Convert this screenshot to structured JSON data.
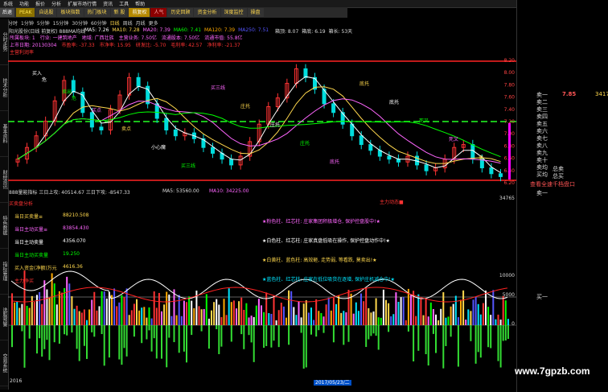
{
  "menu": [
    "系统",
    "功能",
    "报价",
    "分析",
    "扩展市场行情",
    "资讯",
    "工具",
    "帮助"
  ],
  "toolbar": {
    "back_label": "后退",
    "buttons": [
      {
        "label": "PEAK",
        "style": "hot"
      },
      {
        "label": "自选股",
        "style": "yellow"
      },
      {
        "label": "板块指数",
        "style": "yellow"
      },
      {
        "label": "热门板块",
        "style": "yellow"
      },
      {
        "label": "新 股",
        "style": "yellow"
      },
      {
        "label": "前复权",
        "style": "active"
      },
      {
        "label": "人气",
        "style": "red"
      },
      {
        "label": "历史回顾",
        "style": "yellow"
      },
      {
        "label": "资金分析",
        "style": "yellow"
      },
      {
        "label": "深度监控",
        "style": "yellow"
      },
      {
        "label": "操盘",
        "style": "yellow"
      }
    ]
  },
  "periods": [
    "分时",
    "1分钟",
    "5分钟",
    "15分钟",
    "30分钟",
    "60分钟",
    "日线",
    "周线",
    "月线",
    "更多"
  ],
  "active_period": "日线",
  "sidebar_tabs": [
    "分",
    "时",
    "走",
    "势",
    "技",
    "术",
    "分",
    "析",
    "基",
    "本",
    "资",
    "料",
    "财",
    "经",
    "资",
    "讯",
    "特",
    "色",
    "数",
    "据",
    "指",
    "标",
    "管",
    "理",
    "选",
    "股",
    "预",
    "警",
    "交",
    "易",
    "系",
    "统"
  ],
  "main_chart": {
    "header": "阳光股份(日线 前复权)  888MA均线",
    "ma_labels": [
      {
        "text": "MA5: 7.26",
        "color": "#ffffff"
      },
      {
        "text": "MA10: 7.28",
        "color": "#ffd84d"
      },
      {
        "text": "MA20: 7.39",
        "color": "#ff66ff"
      },
      {
        "text": "MA60: 7.41",
        "color": "#00ff00"
      },
      {
        "text": "MA120: 7.39",
        "color": "#ffaa00"
      },
      {
        "text": "MA250: 7.51",
        "color": "#5555ff"
      }
    ],
    "box_labels": [
      {
        "text": "所属板块: 1",
        "color": "#ff66ff"
      },
      {
        "text": "行业: 一建筑地产",
        "color": "#ff66ff"
      },
      {
        "text": "地域: 广西壮族",
        "color": "#ff66ff"
      },
      {
        "text": "主营业务: 7.50亿",
        "color": "#ff66ff"
      },
      {
        "text": "流通股本: 7.50亿",
        "color": "#ff66ff"
      },
      {
        "text": "流通市值: 55.8亿",
        "color": "#ff66ff"
      },
      {
        "text": "上市日期: 20130304",
        "color": "#ff66ff"
      },
      {
        "text": "市盈率: -37.33",
        "color": "#ff3333"
      },
      {
        "text": "市净率: 15.95",
        "color": "#ff3333"
      },
      {
        "text": "研发比: -5.70",
        "color": "#ff3333"
      },
      {
        "text": "毛利率: 42.57",
        "color": "#ff3333"
      },
      {
        "text": "净利率: -21.37",
        "color": "#ff3333"
      },
      {
        "text": "主营利润率",
        "color": "#ff3333"
      }
    ],
    "top_right_labels": [
      "箱顶: 8.07",
      "箱底: 6.19",
      "箱长: 53天"
    ],
    "annotations": [
      "买入",
      "卖出",
      "买点",
      "卖点",
      "小心魔",
      "买三线",
      "买三线",
      "庄托",
      "庄托",
      "庄托",
      "底托",
      "底托",
      "底托",
      "死叉",
      "死叉",
      "卖",
      "危",
      "危"
    ],
    "price_ticks": [
      "8.20",
      "8.00",
      "7.80",
      "7.60",
      "7.40",
      "7.20",
      "7.00",
      "6.80",
      "6.60",
      "6.40",
      "6.20"
    ],
    "chart_data": {
      "type": "candlestick",
      "series": [
        {
          "name": "close",
          "values": [
            6.55,
            6.75,
            6.95,
            7.2,
            7.55,
            7.9,
            7.7,
            7.35,
            7.1,
            7.05,
            7.4,
            7.65,
            7.95,
            7.8,
            7.5,
            7.25,
            7.05,
            6.95,
            7.0,
            6.9,
            6.75,
            6.65,
            6.55,
            6.45,
            6.6,
            6.85,
            7.15,
            7.45,
            7.6,
            7.85,
            8.1,
            7.95,
            7.75,
            7.5,
            7.35,
            7.15,
            6.95,
            6.8,
            6.7,
            6.6,
            6.55,
            6.5,
            6.6,
            6.45,
            6.35,
            6.4,
            6.55,
            6.75,
            6.8,
            6.55,
            6.4,
            6.3,
            6.25
          ]
        }
      ],
      "ylim": [
        6.2,
        8.3
      ]
    }
  },
  "indicator": {
    "header": "888量能指标  三日上攻: 40514.67  三日下攻: -8547.33",
    "ma5": "MA5: 53560.00",
    "ma10": "MA10: 34225.00",
    "left_labels": [
      {
        "text": "买卖盘分析",
        "color": "#ff3333"
      },
      {
        "text": "当日买卖量≡",
        "color": "#ffd84d"
      },
      {
        "text": "88210.508",
        "color": "#ffd84d"
      },
      {
        "text": "当日主动买量≡",
        "color": "#ff66ff"
      },
      {
        "text": "83854.430",
        "color": "#ff66ff"
      },
      {
        "text": "当日主动卖量",
        "color": "#ffffff"
      },
      {
        "text": "4356.070",
        "color": "#ffffff"
      },
      {
        "text": "当日主动买卖量",
        "color": "#00ff00"
      },
      {
        "text": "19.250",
        "color": "#00ff00"
      },
      {
        "text": "买入资金(净额)万元",
        "color": "#ffd84d"
      },
      {
        "text": "4616.36",
        "color": "#ffd84d"
      },
      {
        "text": "主力净买",
        "color": "#ff3333"
      }
    ],
    "legend": [
      {
        "text": "★粉色柱、红芯柱: 庄家集团积极增仓, 保护控盘股中!★",
        "color": "#ff66ff"
      },
      {
        "text": "★白色柱、红芯柱: 庄家真盘低吸在操作, 保护控盘动作中!★",
        "color": "#ffffff"
      },
      {
        "text": "★白黄柱、蓝色柱: 高效砸, 走势弱, 等看跌, 莫卖出!★",
        "color": "#ffd84d"
      },
      {
        "text": "★蓝色柱、红芯柱: 庄家在低位吸货在逐增, 保护庄机减仓中!★",
        "color": "#00e5ff"
      }
    ],
    "top_right_label": "主力动态■",
    "volume_ticks": [
      "34765",
      "10000",
      "5000",
      "0"
    ],
    "date_label": "2017/05/23/二",
    "bottom_left": "2016"
  },
  "orderbook": {
    "current_price": "7.85",
    "current_vol": "3417",
    "sell": [
      "卖一",
      "卖二",
      "卖三",
      "卖四",
      "卖五",
      "卖六",
      "卖七",
      "卖八",
      "卖九",
      "卖十"
    ],
    "buy_totals": [
      "卖均",
      "买均"
    ],
    "summary": [
      "总卖",
      "总买"
    ],
    "quote_link": "查看全速千档盘口",
    "mid": [
      "卖一",
      "买一"
    ]
  },
  "watermark": "www.7gpzb.com"
}
